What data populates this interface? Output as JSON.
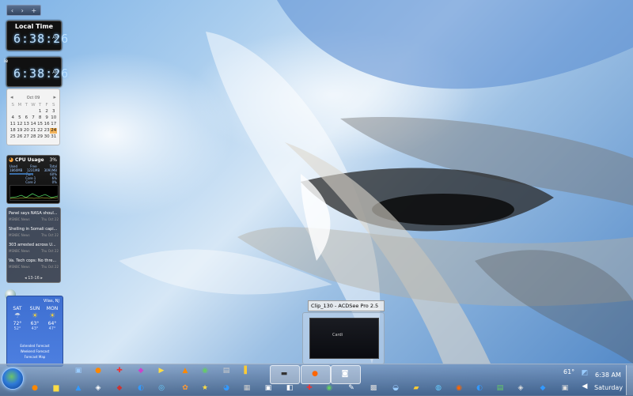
{
  "gadgets": {
    "sidebar_controls": [
      "‹",
      "›",
      "+"
    ],
    "clock1": {
      "title": "Local Time",
      "time": "6:38:26",
      "ampm": "AM"
    },
    "clock2": {
      "label": "ie",
      "time": "6:38:26",
      "ampm": "AM"
    },
    "calendar": {
      "month": "Oct 09",
      "weekdays": [
        "S",
        "M",
        "T",
        "W",
        "T",
        "F",
        "S"
      ],
      "rows": [
        [
          "",
          "",
          "",
          "",
          "1",
          "2",
          "3"
        ],
        [
          "4",
          "5",
          "6",
          "7",
          "8",
          "9",
          "10"
        ],
        [
          "11",
          "12",
          "13",
          "14",
          "15",
          "16",
          "17"
        ],
        [
          "18",
          "19",
          "20",
          "21",
          "22",
          "23",
          "24"
        ],
        [
          "25",
          "26",
          "27",
          "28",
          "29",
          "30",
          "31"
        ]
      ],
      "today": "24"
    },
    "cpu": {
      "title": "CPU Usage",
      "percent": "3%",
      "cols": [
        "Used",
        "Free",
        "Total"
      ],
      "vals": [
        "1860MB",
        "1231MB",
        "3091MB"
      ],
      "ram_label": "Ram",
      "ram_pct": "60%",
      "core1": "Core 1",
      "core1_pct": "6%",
      "core2": "Core 2",
      "core2_pct": "0%"
    },
    "news": {
      "items": [
        {
          "headline": "Panel says NASA shoul...",
          "source": "MSNBC News",
          "date": "Thu Oct 22"
        },
        {
          "headline": "Shelling in Somali capi...",
          "source": "MSNBC News",
          "date": "Thu Oct 22"
        },
        {
          "headline": "303 arrested across U...",
          "source": "MSNBC News",
          "date": "Thu Oct 22"
        },
        {
          "headline": "Va. Tech cops: No thre...",
          "source": "MSNBC News",
          "date": "Thu Oct 22"
        }
      ],
      "pager": "13-16"
    },
    "weather": {
      "location": "Vilas, NJ",
      "days": [
        {
          "name": "SAT",
          "icon": "rain-icon",
          "hi": "72°",
          "lo": "52°"
        },
        {
          "name": "SUN",
          "icon": "sun-icon",
          "hi": "63°",
          "lo": "43°"
        },
        {
          "name": "MON",
          "icon": "sun-icon",
          "hi": "64°",
          "lo": "47°"
        }
      ],
      "links": [
        "Extended Forecast",
        "Weekend Forecast",
        "Forecast Map"
      ]
    }
  },
  "thumbnail": {
    "title": "Clip_130 - ACDSee Pro 2.5",
    "mini_text": "Cardi"
  },
  "taskbar": {
    "tray_temp": "61°",
    "time": "6:38 AM",
    "day": "Saturday"
  },
  "colors": {
    "taskbar": "#5a80ad",
    "weather_bg": "#4577d8",
    "calendar_today": "#f2b35a"
  }
}
